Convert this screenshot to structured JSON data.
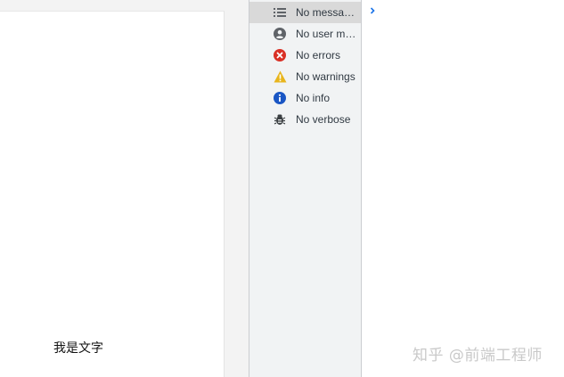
{
  "page": {
    "text": "我是文字"
  },
  "sidebar": {
    "items": [
      {
        "label": "No messages",
        "icon": "list-icon",
        "selected": true
      },
      {
        "label": "No user me...",
        "icon": "user-icon",
        "selected": false
      },
      {
        "label": "No errors",
        "icon": "error-icon",
        "selected": false
      },
      {
        "label": "No warnings",
        "icon": "warning-icon",
        "selected": false
      },
      {
        "label": "No info",
        "icon": "info-icon",
        "selected": false
      },
      {
        "label": "No verbose",
        "icon": "bug-icon",
        "selected": false
      }
    ]
  },
  "watermark": {
    "text": "知乎 @前端工程师"
  },
  "colors": {
    "error": "#d93025",
    "warning": "#e8b51c",
    "info": "#1a56c4",
    "icon": "#5f6368",
    "chevron": "#1a73e8"
  }
}
